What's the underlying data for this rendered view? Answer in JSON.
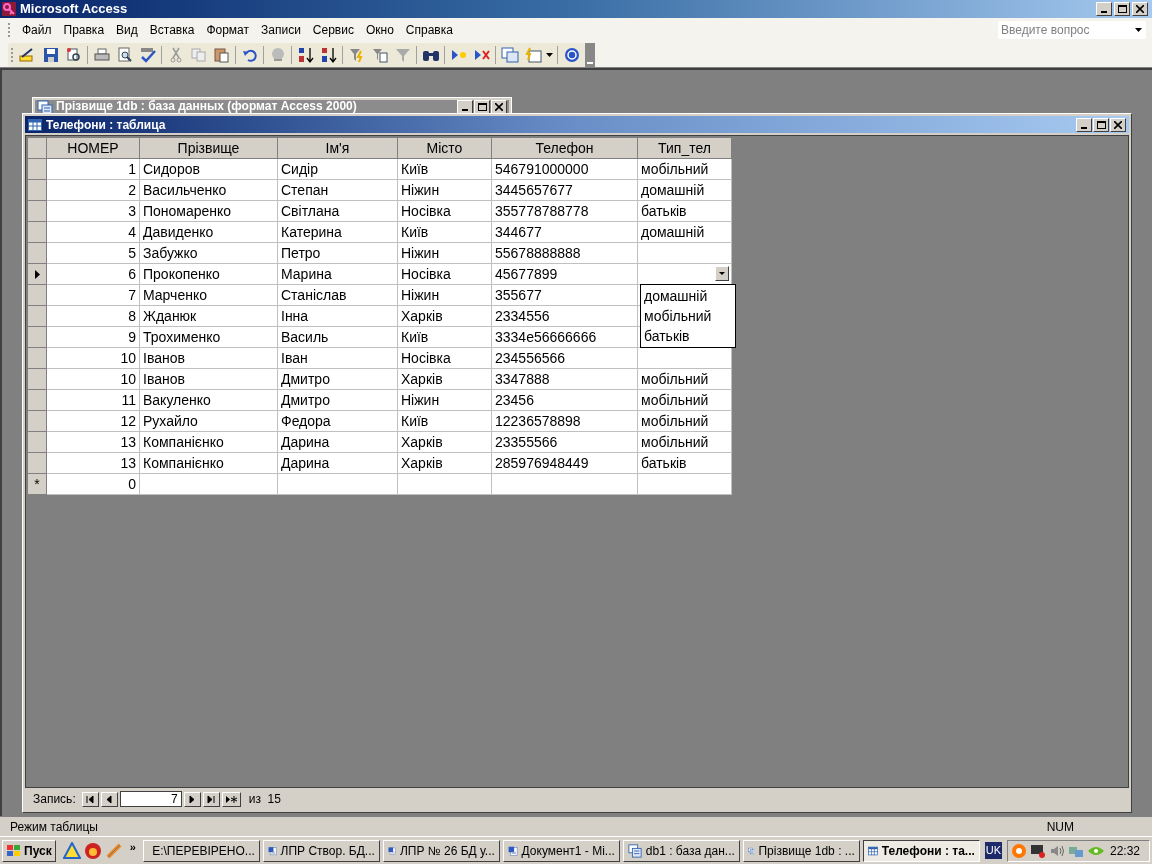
{
  "window": {
    "title": "Microsoft Access"
  },
  "menu": [
    "Файл",
    "Правка",
    "Вид",
    "Вставка",
    "Формат",
    "Записи",
    "Сервис",
    "Окно",
    "Справка"
  ],
  "help_box": {
    "placeholder": "Введите вопрос"
  },
  "back_window": {
    "title": "Прізвище 1db : база данных (формат Access 2000)"
  },
  "table_window": {
    "title": "Телефони : таблица"
  },
  "columns": [
    "НОМЕР",
    "Прізвище",
    "Ім'я",
    "Місто",
    "Телефон",
    "Тип_тел"
  ],
  "rows": [
    {
      "selected": false,
      "cells": [
        "1",
        "Сидоров",
        "Сидір",
        "Київ",
        "546791000000",
        "мобільний"
      ]
    },
    {
      "selected": false,
      "cells": [
        "2",
        "Васильченко",
        "Степан",
        "Ніжин",
        "3445657677",
        "домашній"
      ]
    },
    {
      "selected": false,
      "cells": [
        "3",
        "Пономаренко",
        "Світлана",
        "Носівка",
        "355778788778",
        "батьків"
      ]
    },
    {
      "selected": false,
      "cells": [
        "4",
        "Давиденко",
        "Катерина",
        "Київ",
        "344677",
        "домашній"
      ]
    },
    {
      "selected": false,
      "cells": [
        "5",
        "Забужко",
        "Петро",
        "Ніжин",
        "55678888888"
      ]
    },
    {
      "selected": true,
      "cells": [
        "6",
        "Прокопенко",
        "Марина",
        "Носівка",
        "45677899"
      ]
    },
    {
      "selected": false,
      "cells": [
        "7",
        "Марченко",
        "Станіслав",
        "Ніжин",
        "355677"
      ]
    },
    {
      "selected": false,
      "cells": [
        "8",
        "Жданюк",
        "Інна",
        "Харків",
        "2334556"
      ]
    },
    {
      "selected": false,
      "cells": [
        "9",
        "Трохименко",
        "Василь",
        "Київ",
        "3334е56666666"
      ]
    },
    {
      "selected": false,
      "cells": [
        "10",
        "Іванов",
        "Іван",
        "Носівка",
        "234556566"
      ]
    },
    {
      "selected": false,
      "cells": [
        "10",
        "Іванов",
        "Дмитро",
        "Харків",
        "3347888",
        "мобільний"
      ]
    },
    {
      "selected": false,
      "cells": [
        "11",
        "Вакуленко",
        "Дмитро",
        "Ніжин",
        "23456",
        "мобільний"
      ]
    },
    {
      "selected": false,
      "cells": [
        "12",
        "Рухайло",
        "Федора",
        "Київ",
        "12236578898",
        "мобільний"
      ]
    },
    {
      "selected": false,
      "cells": [
        "13",
        "Компанієнко",
        "Дарина",
        "Харків",
        "23355566",
        "мобільний"
      ]
    },
    {
      "selected": false,
      "cells": [
        "13",
        "Компанієнко",
        "Дарина",
        "Харків",
        "285976948449",
        "батьків"
      ]
    }
  ],
  "new_row": {
    "marker": "*",
    "number": "0"
  },
  "dropdown": {
    "options": [
      "домашній",
      "мобільний",
      "батьків"
    ]
  },
  "navigator": {
    "label": "Запись:",
    "value": "7",
    "total": "из  15"
  },
  "status_bar": {
    "mode": "Режим таблицы",
    "indicator": "NUM"
  },
  "taskbar": {
    "start": "Пуск",
    "more": "»",
    "tasks": [
      {
        "label": "E:\\ПЕРЕВІРЕНО...",
        "kind": "folder",
        "selected": false
      },
      {
        "label": "ЛПР Створ. БД...",
        "kind": "word",
        "selected": false
      },
      {
        "label": "ЛПР № 26 БД у...",
        "kind": "word",
        "selected": false
      },
      {
        "label": "Документ1 - Mi...",
        "kind": "word",
        "selected": false
      },
      {
        "label": "db1 : база дан...",
        "kind": "db",
        "selected": false
      },
      {
        "label": "Прізвище 1db : ...",
        "kind": "db",
        "selected": false
      },
      {
        "label": "Телефони : та...",
        "kind": "table",
        "selected": true
      }
    ],
    "language": "UK",
    "clock": "22:32"
  }
}
